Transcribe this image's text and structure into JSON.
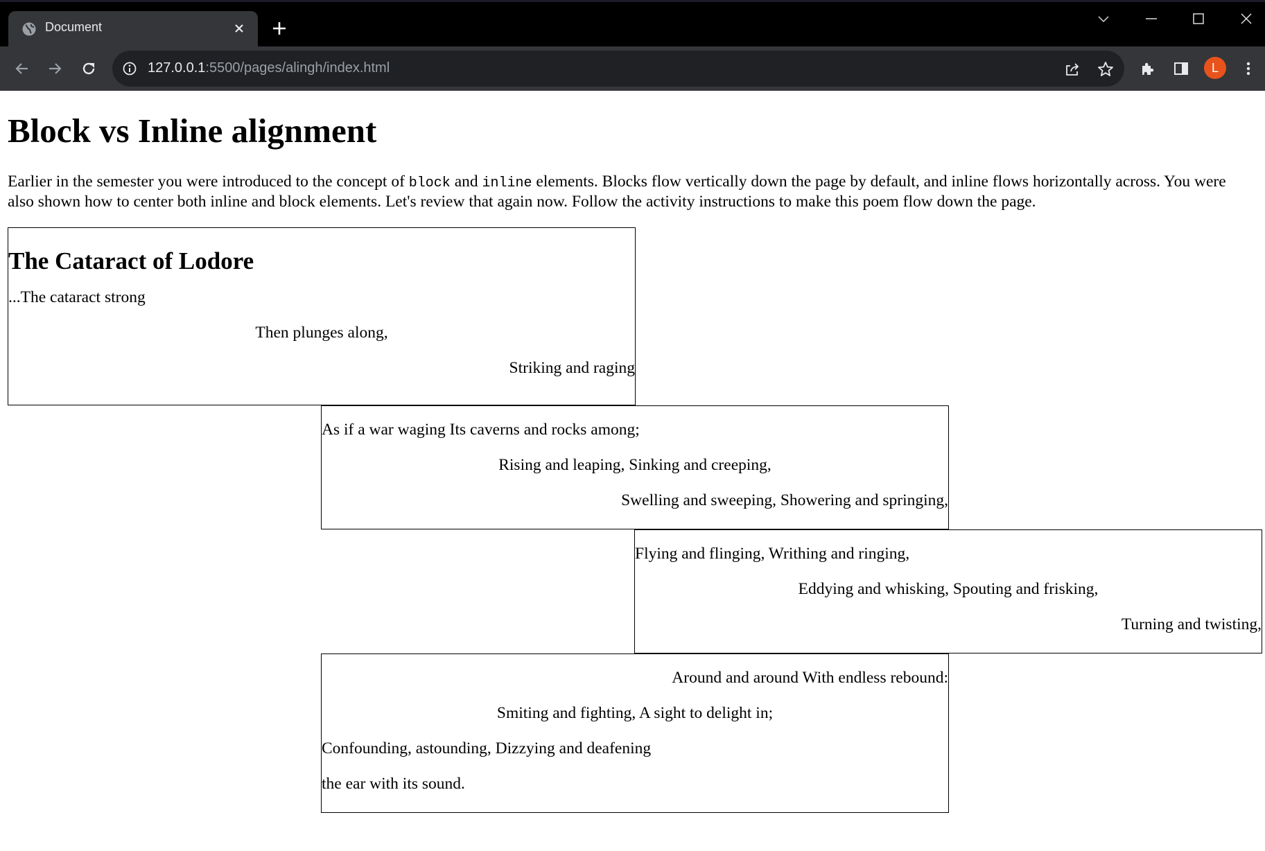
{
  "browser": {
    "tab_title": "Document",
    "url_host": "127.0.0.1",
    "url_path": ":5500/pages/alingh/index.html",
    "profile_initial": "L",
    "profile_color": "#e8531c"
  },
  "page": {
    "title": "Block vs Inline alignment",
    "intro_before": "Earlier in the semester you were introduced to the concept of",
    "intro_code1": "block",
    "intro_and": "and",
    "intro_code2": "inline",
    "intro_after": "elements. Blocks flow vertically down the page by default, and inline flows horizontally across. You were also shown how to center both inline and block elements. Let's review that again now. Follow the activity instructions to make this poem flow down the page."
  },
  "poem": {
    "title": "The Cataract of Lodore",
    "stanza1": [
      "...The cataract strong",
      "Then plunges along,",
      "Striking and raging"
    ],
    "stanza2": [
      "As if a war waging Its caverns and rocks among;",
      "Rising and leaping, Sinking and creeping,",
      "Swelling and sweeping, Showering and springing,"
    ],
    "stanza3": [
      "Flying and flinging, Writhing and ringing,",
      "Eddying and whisking, Spouting and frisking,",
      "Turning and twisting,"
    ],
    "stanza4": [
      "Around and around With endless rebound:",
      "Smiting and fighting, A sight to delight in;",
      "Confounding, astounding, Dizzying and deafening",
      "the ear with its sound."
    ]
  }
}
